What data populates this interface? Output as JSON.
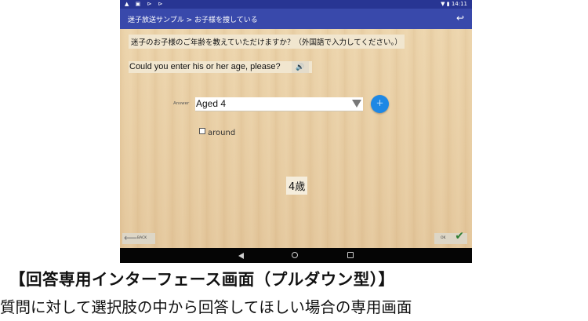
{
  "status_bar": {
    "left_icons": "▲ ▣ ⊳ ⊳",
    "right": "▼ ▮ 14:11"
  },
  "app_bar": {
    "title": "迷子放送サンプル > お子様を捜している",
    "back_icon": "↩"
  },
  "question": {
    "japanese": "迷子のお子様のご年齢を教えていただけますか？（外国語で入力してください。）",
    "english": "Could you enter his or her age, please?",
    "speaker_icon": "🔊"
  },
  "answer": {
    "label": "Answer",
    "selected": "Aged 4",
    "fab_glyph": "＋"
  },
  "checkbox": {
    "label": "around"
  },
  "result": {
    "text": "4歳"
  },
  "footer": {
    "back_label": "BACK",
    "back_arrow": "⟵",
    "ok_label": "OK",
    "ok_check": "✔"
  },
  "caption": {
    "title": "【回答専用インターフェース画面（プルダウン型）】",
    "subtitle": "質問に対して選択肢の中から回答してほしい場合の専用画面"
  },
  "colors": {
    "status_bar": "#283593",
    "app_bar": "#3949ab",
    "fab": "#1e88e5",
    "ok_check": "#2e7d32"
  }
}
